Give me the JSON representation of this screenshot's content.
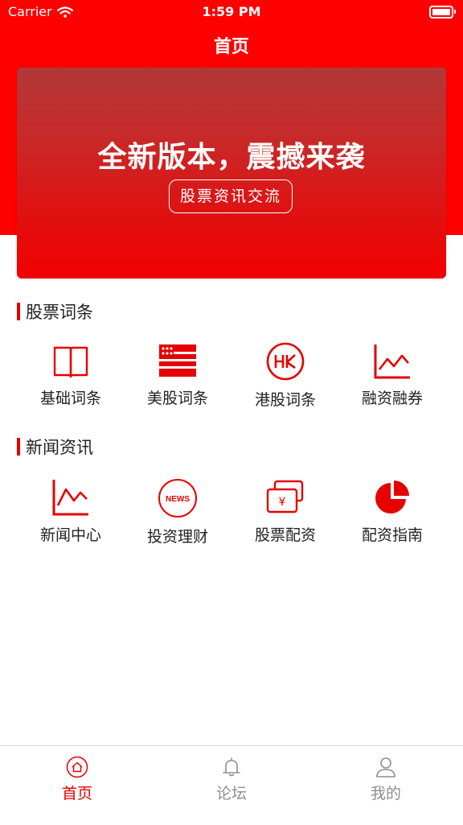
{
  "status_bar": {
    "carrier": "Carrier",
    "time": "1:59 PM"
  },
  "nav": {
    "title": "首页"
  },
  "banner": {
    "headline": "全新版本，震撼来袭",
    "button_label": "股票资讯交流"
  },
  "sections": [
    {
      "title": "股票词条",
      "items": [
        {
          "label": "基础词条",
          "icon": "book-icon"
        },
        {
          "label": "美股词条",
          "icon": "us-flag-icon"
        },
        {
          "label": "港股词条",
          "icon": "hk-badge-icon"
        },
        {
          "label": "融资融券",
          "icon": "line-chart-icon"
        }
      ]
    },
    {
      "title": "新闻资讯",
      "items": [
        {
          "label": "新闻中心",
          "icon": "line-chart-icon"
        },
        {
          "label": "投资理财",
          "icon": "news-badge-icon",
          "icon_text": "NEWS"
        },
        {
          "label": "股票配资",
          "icon": "yen-cards-icon",
          "icon_text": "¥"
        },
        {
          "label": "配资指南",
          "icon": "pie-chart-icon"
        }
      ]
    }
  ],
  "tabbar": {
    "items": [
      {
        "label": "首页",
        "icon": "home-icon",
        "active": true
      },
      {
        "label": "论坛",
        "icon": "bell-icon",
        "active": false
      },
      {
        "label": "我的",
        "icon": "user-icon",
        "active": false
      }
    ]
  },
  "colors": {
    "accent": "#e60000",
    "header_red": "#ff0000",
    "inactive_tab": "#8e8e93"
  }
}
